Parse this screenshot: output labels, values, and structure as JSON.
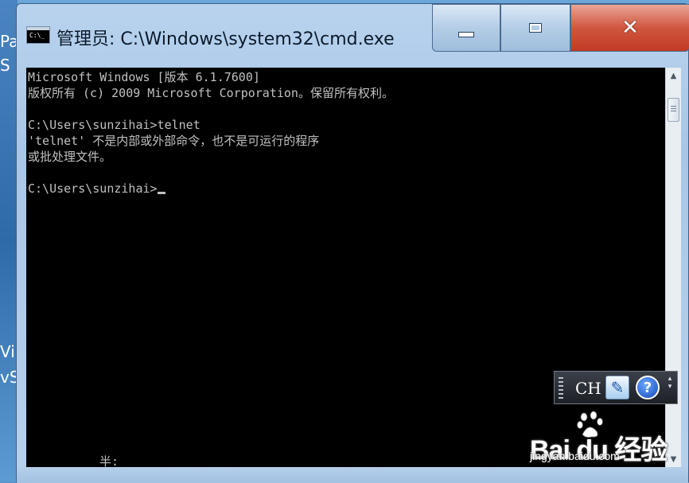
{
  "window": {
    "title": "管理员: C:\\Windows\\system32\\cmd.exe",
    "icon_text": "C:\\_"
  },
  "console": {
    "lines": [
      "Microsoft Windows [版本 6.1.7600]",
      "版权所有 (c) 2009 Microsoft Corporation。保留所有权利。",
      "",
      "C:\\Users\\sunzihai>telnet",
      "'telnet' 不是内部或外部命令，也不是可运行的程序",
      "或批处理文件。",
      "",
      "C:\\Users\\sunzihai>"
    ],
    "ime_status": "半:"
  },
  "language_bar": {
    "code": "CH",
    "help_label": "?"
  },
  "desktop": {
    "partial_labels": [
      "Pa",
      "S",
      "Vi",
      "vS"
    ]
  },
  "watermark": {
    "logo": "Bai du 经验",
    "url": "jingyan.baidu.com"
  },
  "colors": {
    "console_bg": "#000000",
    "console_fg": "#c0c0c0",
    "close_button": "#c9432c"
  }
}
